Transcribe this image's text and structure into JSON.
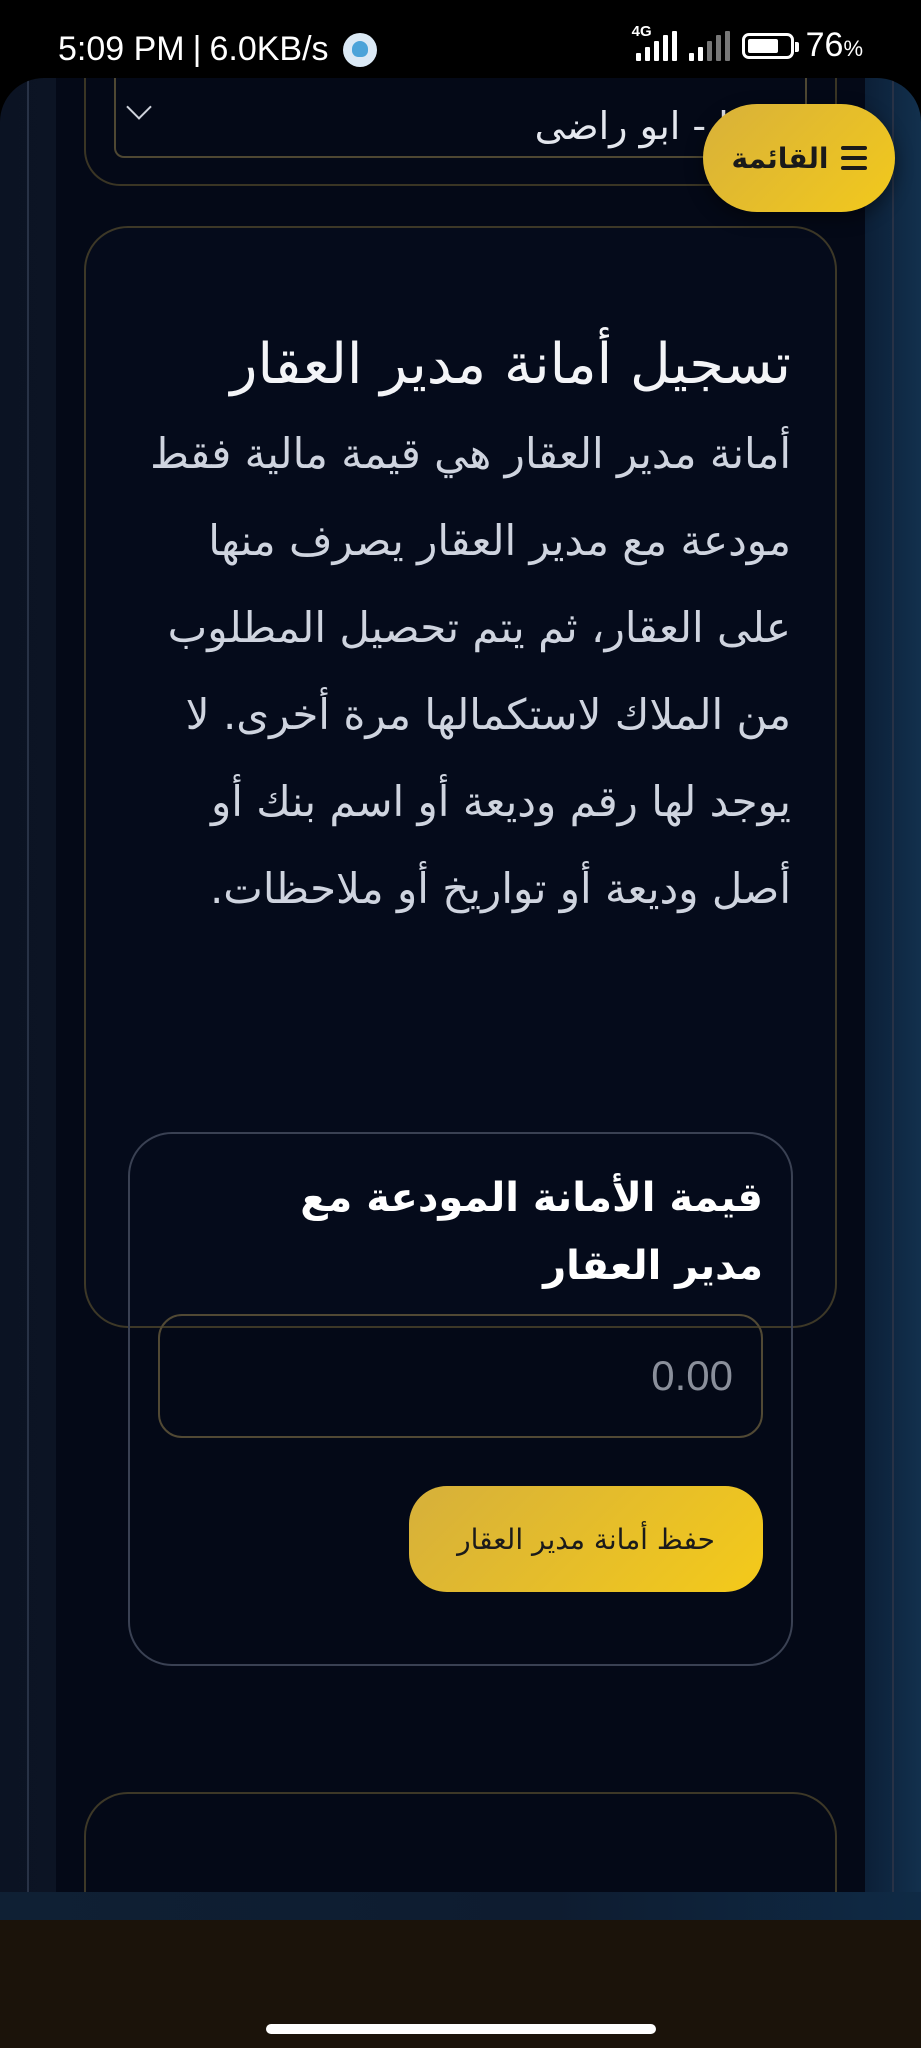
{
  "status_bar": {
    "time": "5:09 PM",
    "separator": "|",
    "net_speed": "6.0KB/s",
    "network_type": "4G",
    "battery_percent": "76",
    "battery_unit": "%",
    "battery_level": 0.76,
    "icons": [
      "app-notification-icon",
      "signal-4g-icon",
      "signal-icon",
      "battery-icon"
    ]
  },
  "menu_button": {
    "label": "القائمة",
    "icon": "hamburger-icon"
  },
  "property_select": {
    "value": "...ا - ابو راضى",
    "icon": "chevron-down-icon"
  },
  "manager_deposit": {
    "title": "تسجيل أمانة مدير العقار",
    "description": "أمانة مدير العقار هي قيمة مالية فقط مودعة مع مدير العقار يصرف منها على العقار، ثم يتم تحصيل المطلوب من الملاك لاستكمالها مرة أخرى. لا يوجد لها رقم وديعة أو اسم بنك أو أصل وديعة أو تواريخ أو ملاحظات.",
    "field_label": "قيمة الأمانة المودعة مع مدير العقار",
    "amount_placeholder": "0.00",
    "save_label": "حفظ أمانة مدير العقار"
  },
  "colors": {
    "accent": "#f2c91c",
    "accent_dark": "#d6b03b",
    "background": "#050b19",
    "card_border": "#3d3827"
  }
}
